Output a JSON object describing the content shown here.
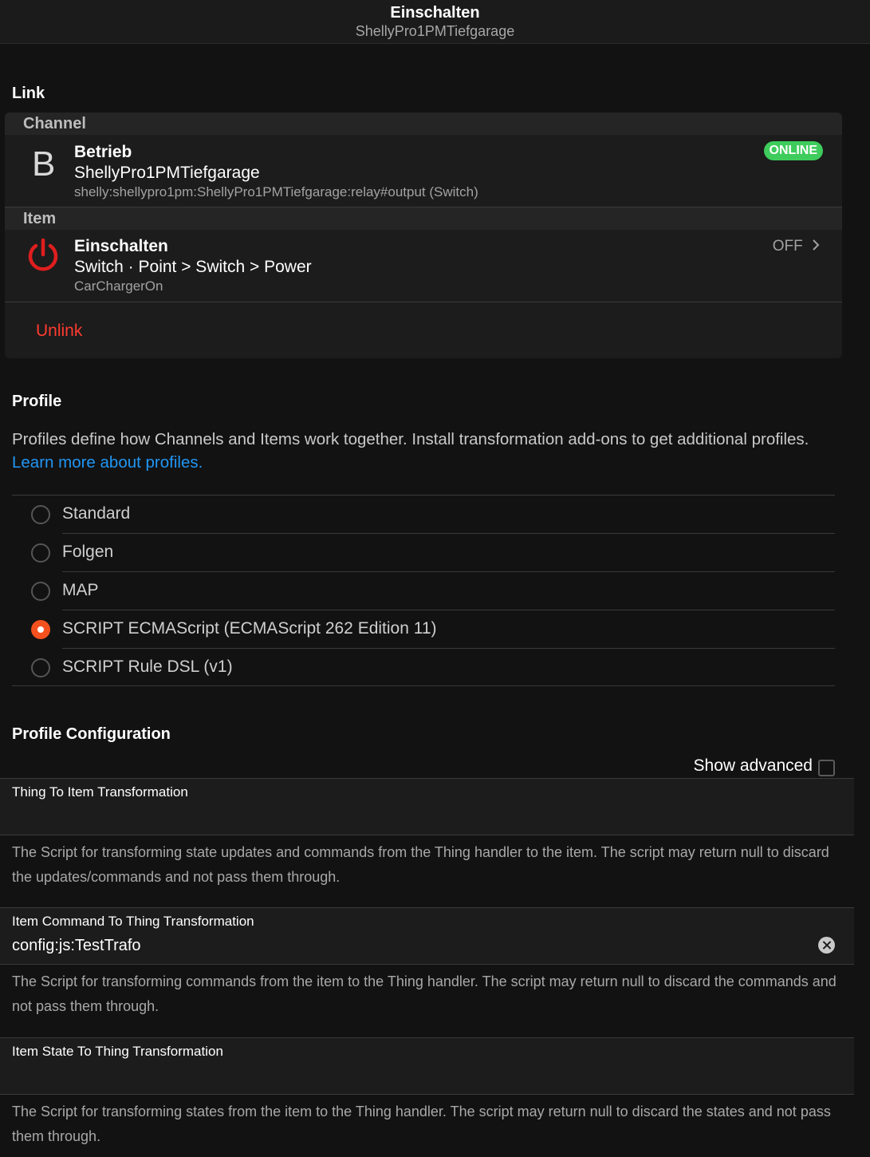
{
  "header": {
    "title": "Einschalten",
    "subtitle": "ShellyPro1PMTiefgarage"
  },
  "link": {
    "title": "Link",
    "channel_header": "Channel",
    "channel": {
      "icon_letter": "B",
      "title": "Betrieb",
      "subtitle": "ShellyPro1PMTiefgarage",
      "uid": "shelly:shellypro1pm:ShellyPro1PMTiefgarage:relay#output (Switch)",
      "status": "ONLINE",
      "status_color": "#3ecc5c"
    },
    "item_header": "Item",
    "item": {
      "icon": "power-icon",
      "title": "Einschalten",
      "subtitle": "Switch · Point > Switch > Power",
      "name": "CarChargerOn",
      "state": "OFF"
    },
    "unlink_label": "Unlink"
  },
  "profile": {
    "title": "Profile",
    "description": "Profiles define how Channels and Items work together. Install transformation add-ons to get additional profiles.",
    "learn_more": "Learn more about profiles.",
    "options": [
      {
        "label": "Standard",
        "selected": false
      },
      {
        "label": "Folgen",
        "selected": false
      },
      {
        "label": "MAP",
        "selected": false
      },
      {
        "label": "SCRIPT ECMAScript (ECMAScript 262 Edition 11)",
        "selected": true
      },
      {
        "label": "SCRIPT Rule DSL (v1)",
        "selected": false
      }
    ],
    "accent_color": "#f4511e"
  },
  "profile_config": {
    "title": "Profile Configuration",
    "show_advanced": "Show advanced",
    "fields": [
      {
        "label": "Thing To Item Transformation",
        "value": "",
        "help": "The Script for transforming state updates and commands from the Thing handler to the item. The script may return null to discard the updates/commands and not pass them through."
      },
      {
        "label": "Item Command To Thing Transformation",
        "value": "config:js:TestTrafo",
        "help": "The Script for transforming commands from the item to the Thing handler. The script may return null to discard the commands and not pass them through."
      },
      {
        "label": "Item State To Thing Transformation",
        "value": "",
        "help": "The Script for transforming states from the item to the Thing handler. The script may return null to discard the states and not pass them through."
      }
    ]
  }
}
